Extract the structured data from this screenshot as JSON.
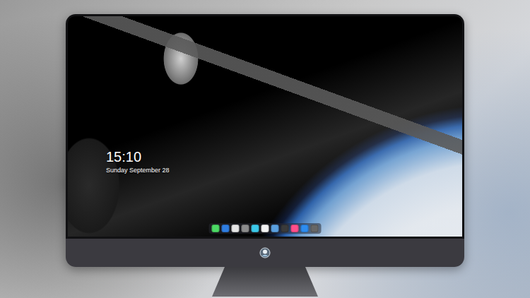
{
  "lock_screen": {
    "time": "15:10",
    "date": "Sunday September 28"
  },
  "dock": {
    "items": [
      {
        "color": "#4cd964"
      },
      {
        "color": "#2f7de1"
      },
      {
        "color": "#e6e6e6"
      },
      {
        "color": "#8c8c8c"
      },
      {
        "color": "#3cc8e8"
      },
      {
        "color": "#f4f4f4"
      },
      {
        "color": "#5aa0e0"
      },
      {
        "color": "#3a3a3a"
      },
      {
        "color": "#ff4f8b"
      },
      {
        "color": "#2d8cf0"
      },
      {
        "color": "#666666"
      }
    ]
  }
}
